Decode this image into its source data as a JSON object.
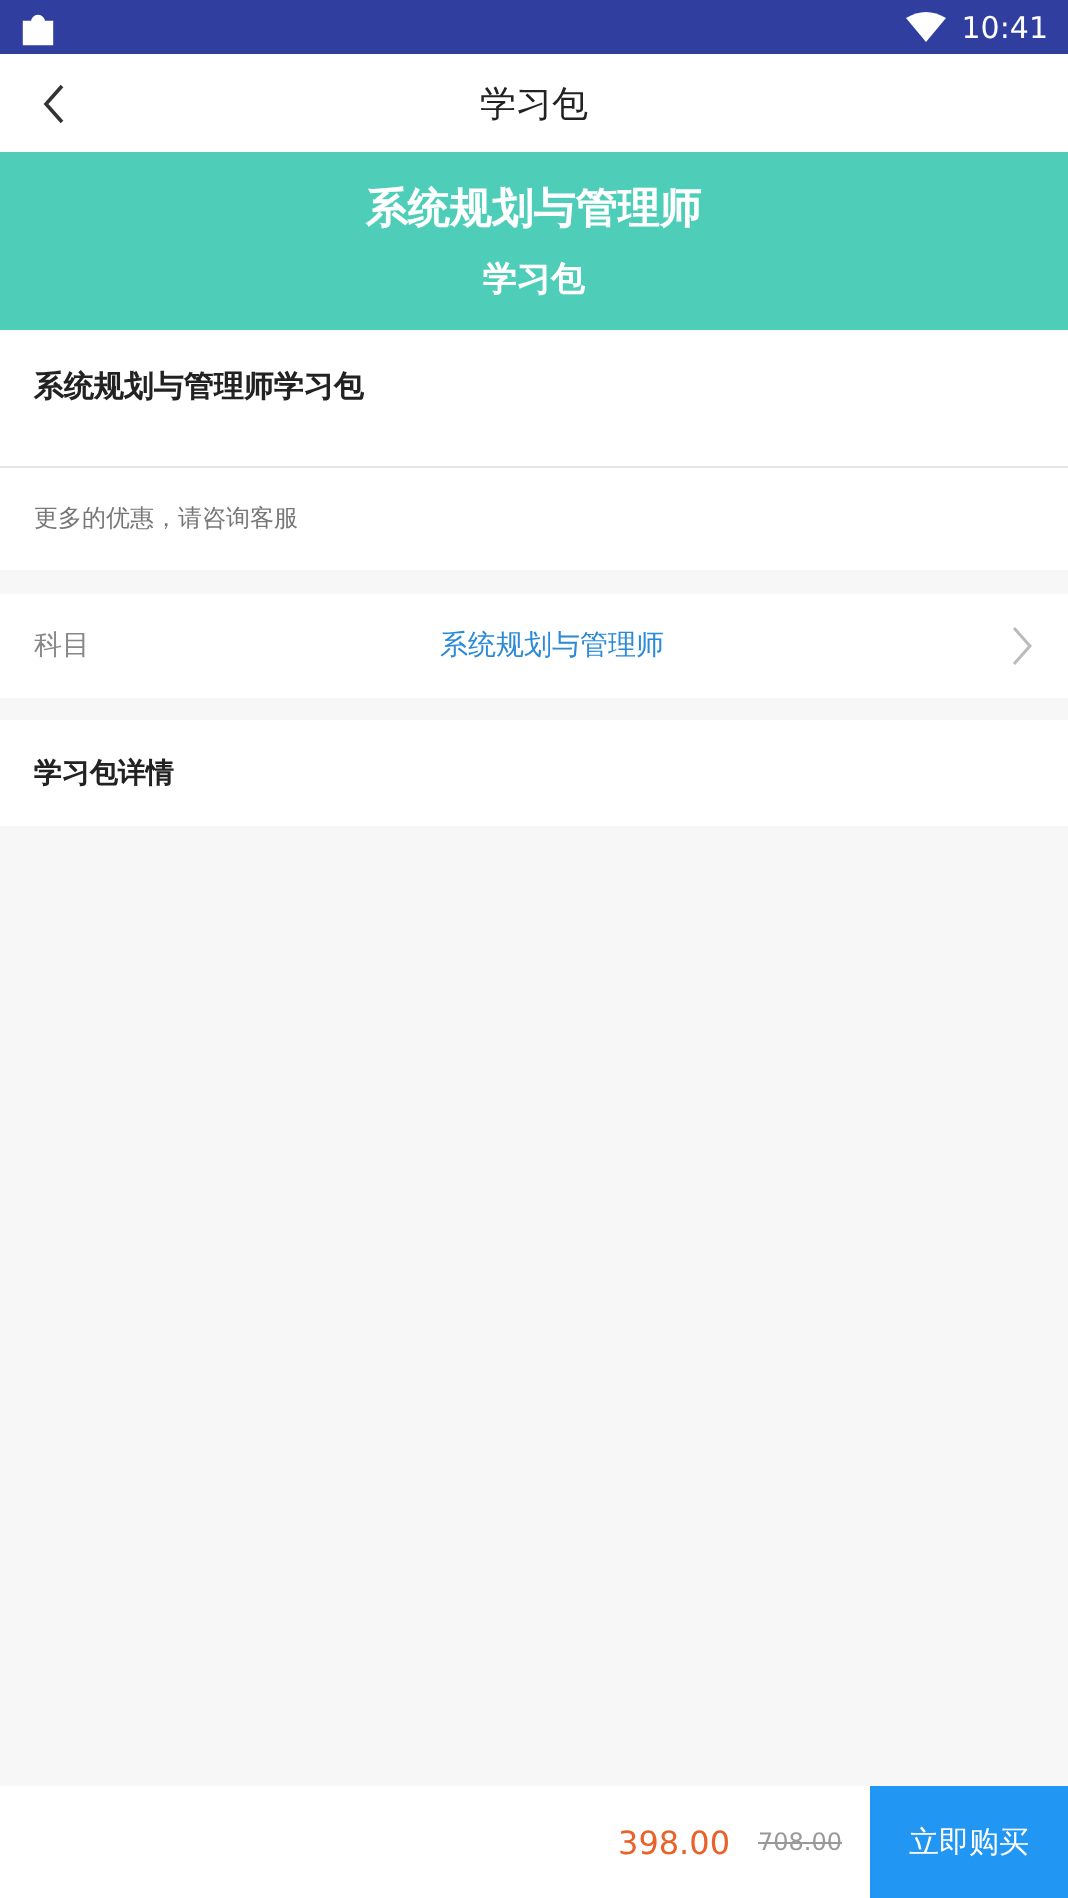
{
  "status_bar": {
    "time": "10:41"
  },
  "header": {
    "title": "学习包"
  },
  "banner": {
    "title": "系统规划与管理师",
    "subtitle": "学习包"
  },
  "package": {
    "name": "系统规划与管理师学习包",
    "note": "更多的优惠，请咨询客服"
  },
  "subject": {
    "label": "科目",
    "value": "系统规划与管理师"
  },
  "details": {
    "title": "学习包详情"
  },
  "footer": {
    "price": "398.00",
    "original_price": "708.00",
    "buy_button": "立即购买"
  }
}
